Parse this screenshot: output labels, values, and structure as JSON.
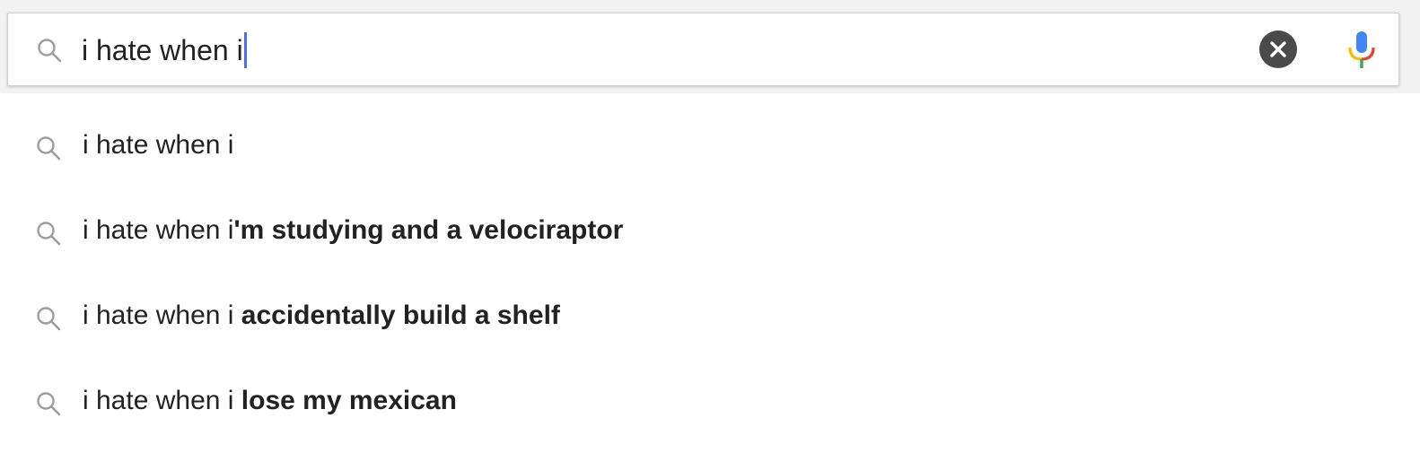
{
  "search": {
    "query": "i hate when i",
    "clear_icon": "close-icon",
    "mic_icon": "mic-icon",
    "search_icon": "search-icon"
  },
  "suggestions": [
    {
      "typed": "i hate when i",
      "completion": ""
    },
    {
      "typed": "i hate when i",
      "completion": "'m studying and a velociraptor"
    },
    {
      "typed": "i hate when i ",
      "completion": "accidentally build a shelf"
    },
    {
      "typed": "i hate when i ",
      "completion": "lose my mexican"
    }
  ],
  "colors": {
    "caret": "#4a6cf7",
    "clear_button": "#4a4a4a",
    "mic_blue": "#4285f4",
    "mic_red": "#ea4335",
    "mic_yellow": "#fbbc05",
    "mic_green": "#34a853",
    "icon_gray": "#9e9e9e"
  }
}
